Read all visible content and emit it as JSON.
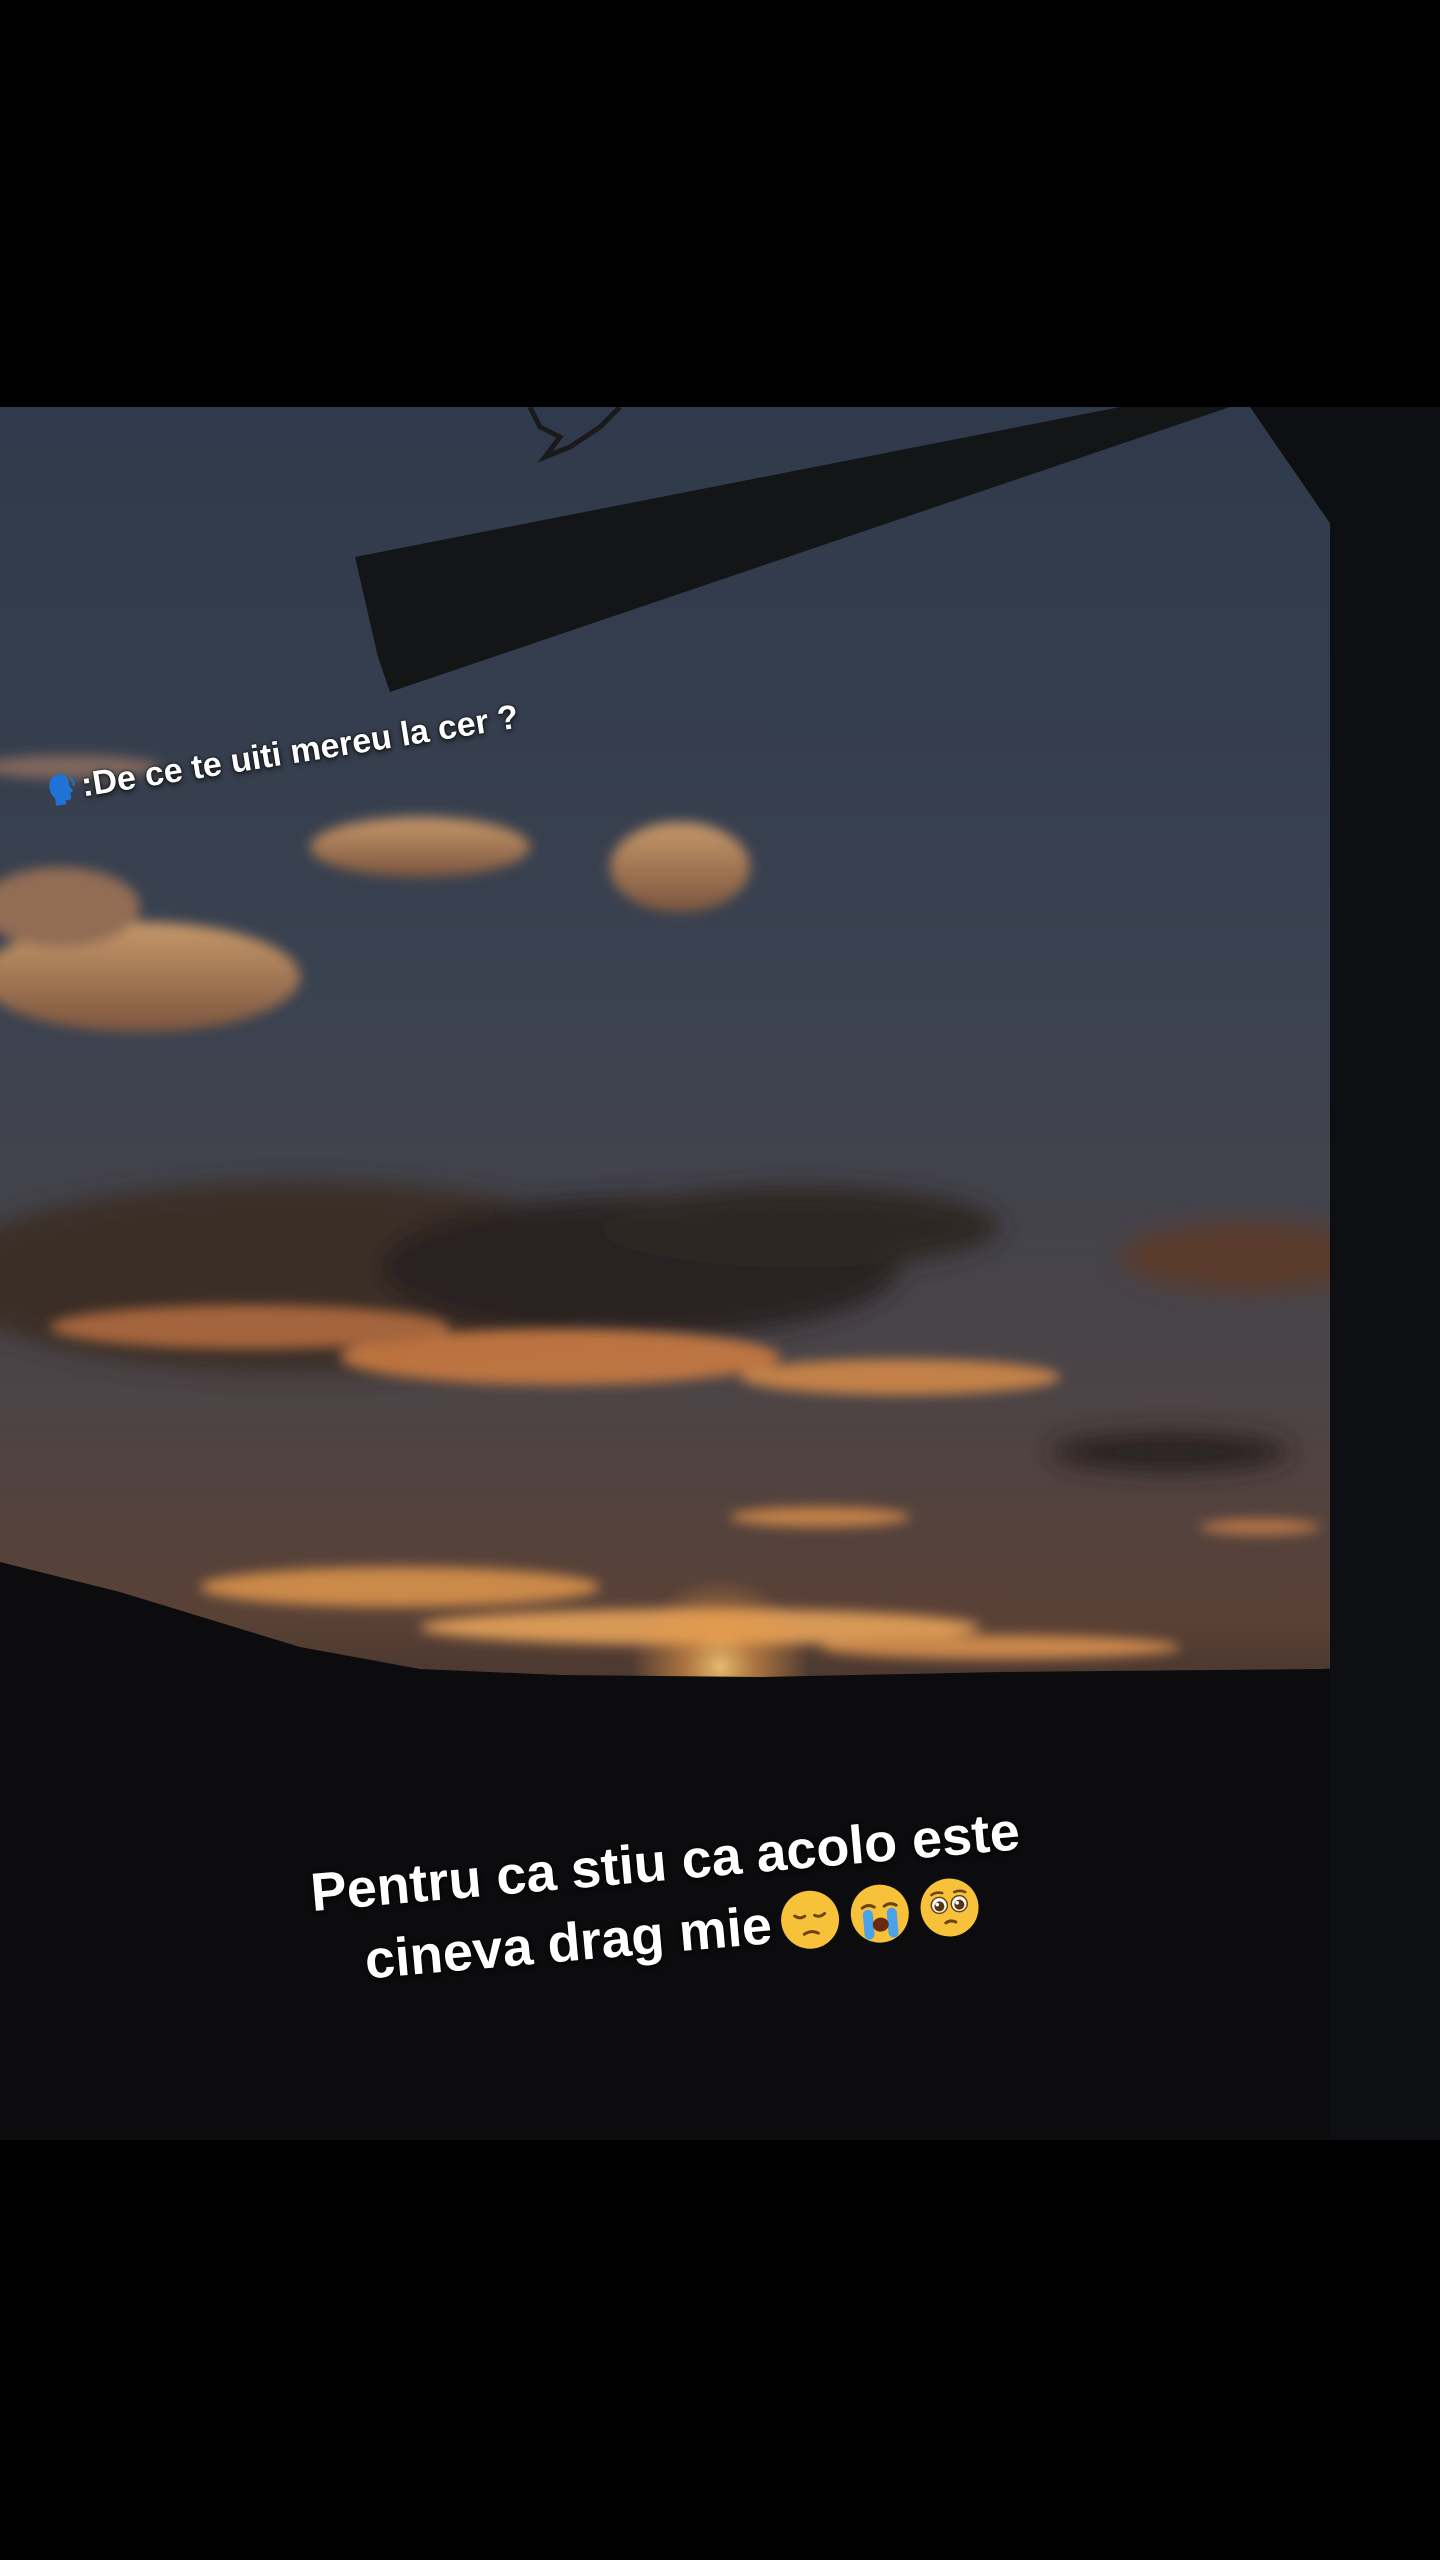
{
  "colors": {
    "page_background": "#000000",
    "sky_top": "#2b3748",
    "sky_mid": "#3d4452",
    "sunset_glow": "#e89a4a",
    "caption_text": "#ffffff",
    "speaker_icon": "#1e73d6"
  },
  "overlay": {
    "question_text": ":De ce te uiti mereu la cer ?",
    "question_icon": "speaking-head-icon",
    "answer_line1": "Pentru ca stiu ca acolo este",
    "answer_line2": "cineva drag mie",
    "answer_emojis": [
      "pensive-face-icon",
      "loudly-crying-face-icon",
      "pleading-face-icon"
    ]
  }
}
